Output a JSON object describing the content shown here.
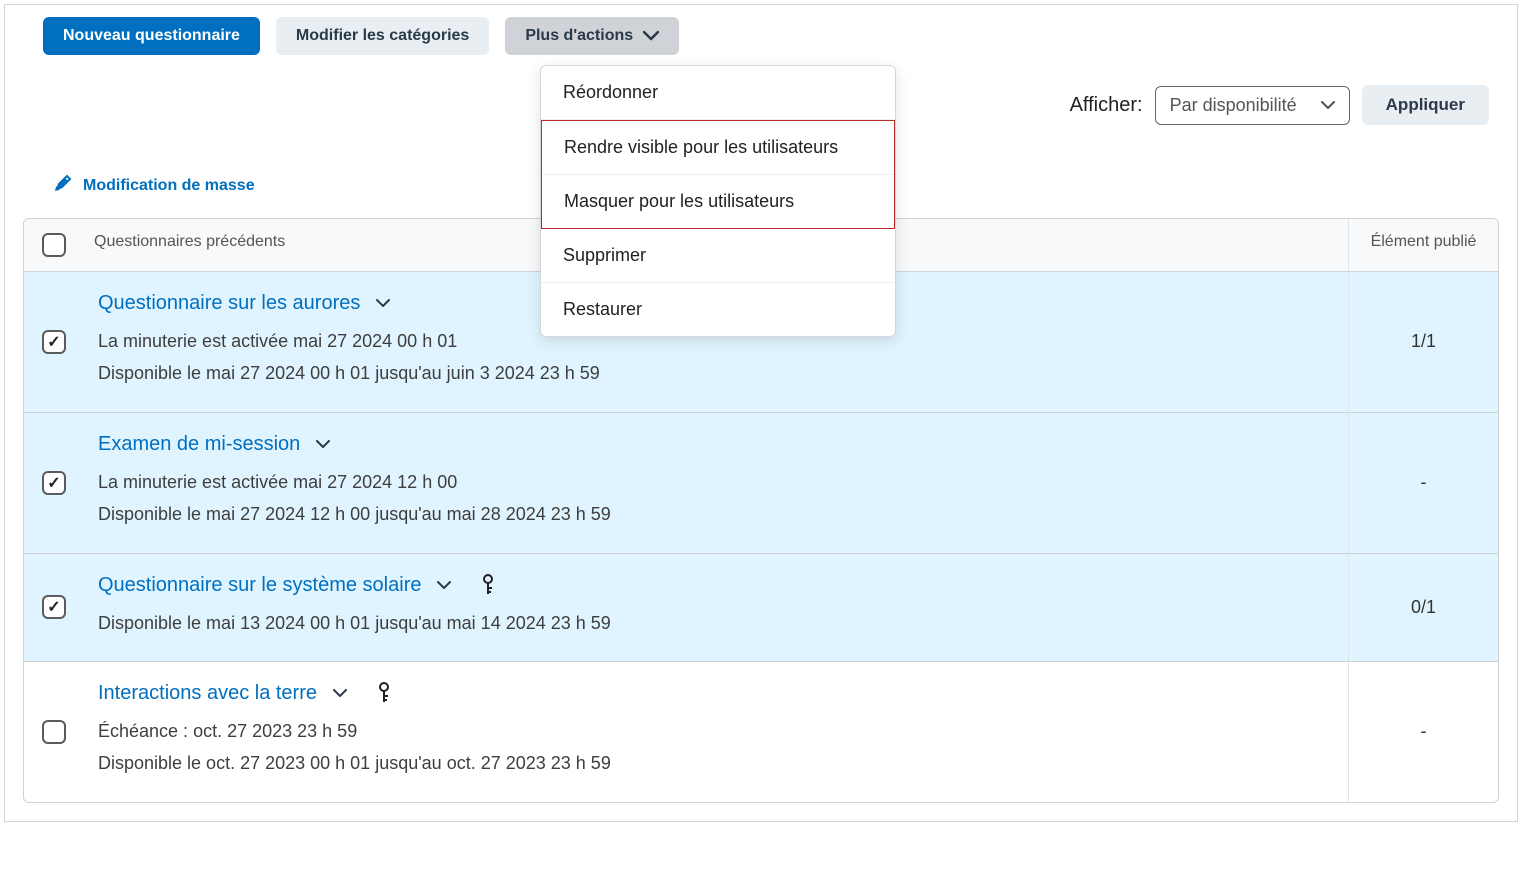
{
  "toolbar": {
    "new_quiz": "Nouveau questionnaire",
    "edit_categories": "Modifier les catégories",
    "more_actions": "Plus d'actions"
  },
  "dropdown": {
    "reorder": "Réordonner",
    "make_visible": "Rendre visible pour les utilisateurs",
    "hide": "Masquer pour les utilisateurs",
    "delete": "Supprimer",
    "restore": "Restaurer"
  },
  "filter": {
    "label": "Afficher:",
    "value": "Par disponibilité",
    "apply": "Appliquer"
  },
  "bulk_edit": "Modification de masse",
  "table": {
    "header_title": "Questionnaires précédents",
    "header_published": "Élément publié"
  },
  "rows": [
    {
      "checked": true,
      "title": "Questionnaire sur les aurores",
      "line1": "La minuterie est activée mai 27 2024 00 h 01",
      "line2": "Disponible le mai 27 2024 00 h 01 jusqu'au juin 3 2024 23 h 59",
      "published": "1/1",
      "has_key": false
    },
    {
      "checked": true,
      "title": "Examen de mi-session",
      "line1": "La minuterie est activée mai 27 2024 12 h 00",
      "line2": "Disponible le mai 27 2024 12 h 00 jusqu'au mai 28 2024 23 h 59",
      "published": "-",
      "has_key": false
    },
    {
      "checked": true,
      "title": "Questionnaire sur le système solaire",
      "line1": "Disponible le mai 13 2024 00 h 01 jusqu'au mai 14 2024 23 h 59",
      "line2": "",
      "published": "0/1",
      "has_key": true
    },
    {
      "checked": false,
      "title": "Interactions avec la terre",
      "line1": "Échéance : oct. 27 2023 23 h 59",
      "line2": "Disponible le oct. 27 2023 00 h 01 jusqu'au oct. 27 2023 23 h 59",
      "published": "-",
      "has_key": true
    }
  ]
}
